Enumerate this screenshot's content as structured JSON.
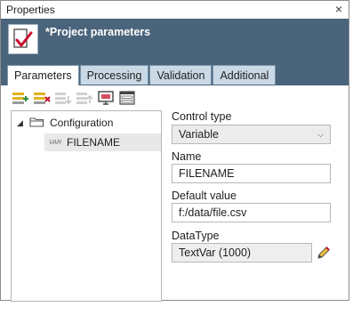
{
  "window": {
    "title": "Properties",
    "close_glyph": "×"
  },
  "header": {
    "title": "*Project parameters",
    "icon": "document-check-icon"
  },
  "tabs": [
    {
      "label": "Parameters",
      "active": true
    },
    {
      "label": "Processing",
      "active": false
    },
    {
      "label": "Validation",
      "active": false
    },
    {
      "label": "Additional",
      "active": false
    }
  ],
  "toolbar": [
    {
      "name": "add-parameter-icon",
      "enabled": true
    },
    {
      "name": "remove-parameter-icon",
      "enabled": true
    },
    {
      "name": "move-down-icon",
      "enabled": false
    },
    {
      "name": "move-up-icon",
      "enabled": false
    },
    {
      "name": "monitor-icon",
      "enabled": true
    },
    {
      "name": "form-icon",
      "enabled": true
    }
  ],
  "tree": {
    "root": {
      "label": "Configuration",
      "expander": "◢"
    },
    "children": [
      {
        "label": "FILENAME",
        "badge": "VAR"
      }
    ]
  },
  "form": {
    "control_type": {
      "label": "Control type",
      "value": "Variable",
      "caret": "⌵"
    },
    "name": {
      "label": "Name",
      "value": "FILENAME"
    },
    "default_value": {
      "label": "Default value",
      "value": "f:/data/file.csv"
    },
    "data_type": {
      "label": "DataType",
      "value": "TextVar (1000)"
    }
  },
  "colors": {
    "header_bg": "#4a647b",
    "tab_bg": "#c9d9e6",
    "check_red": "#c8102e"
  }
}
